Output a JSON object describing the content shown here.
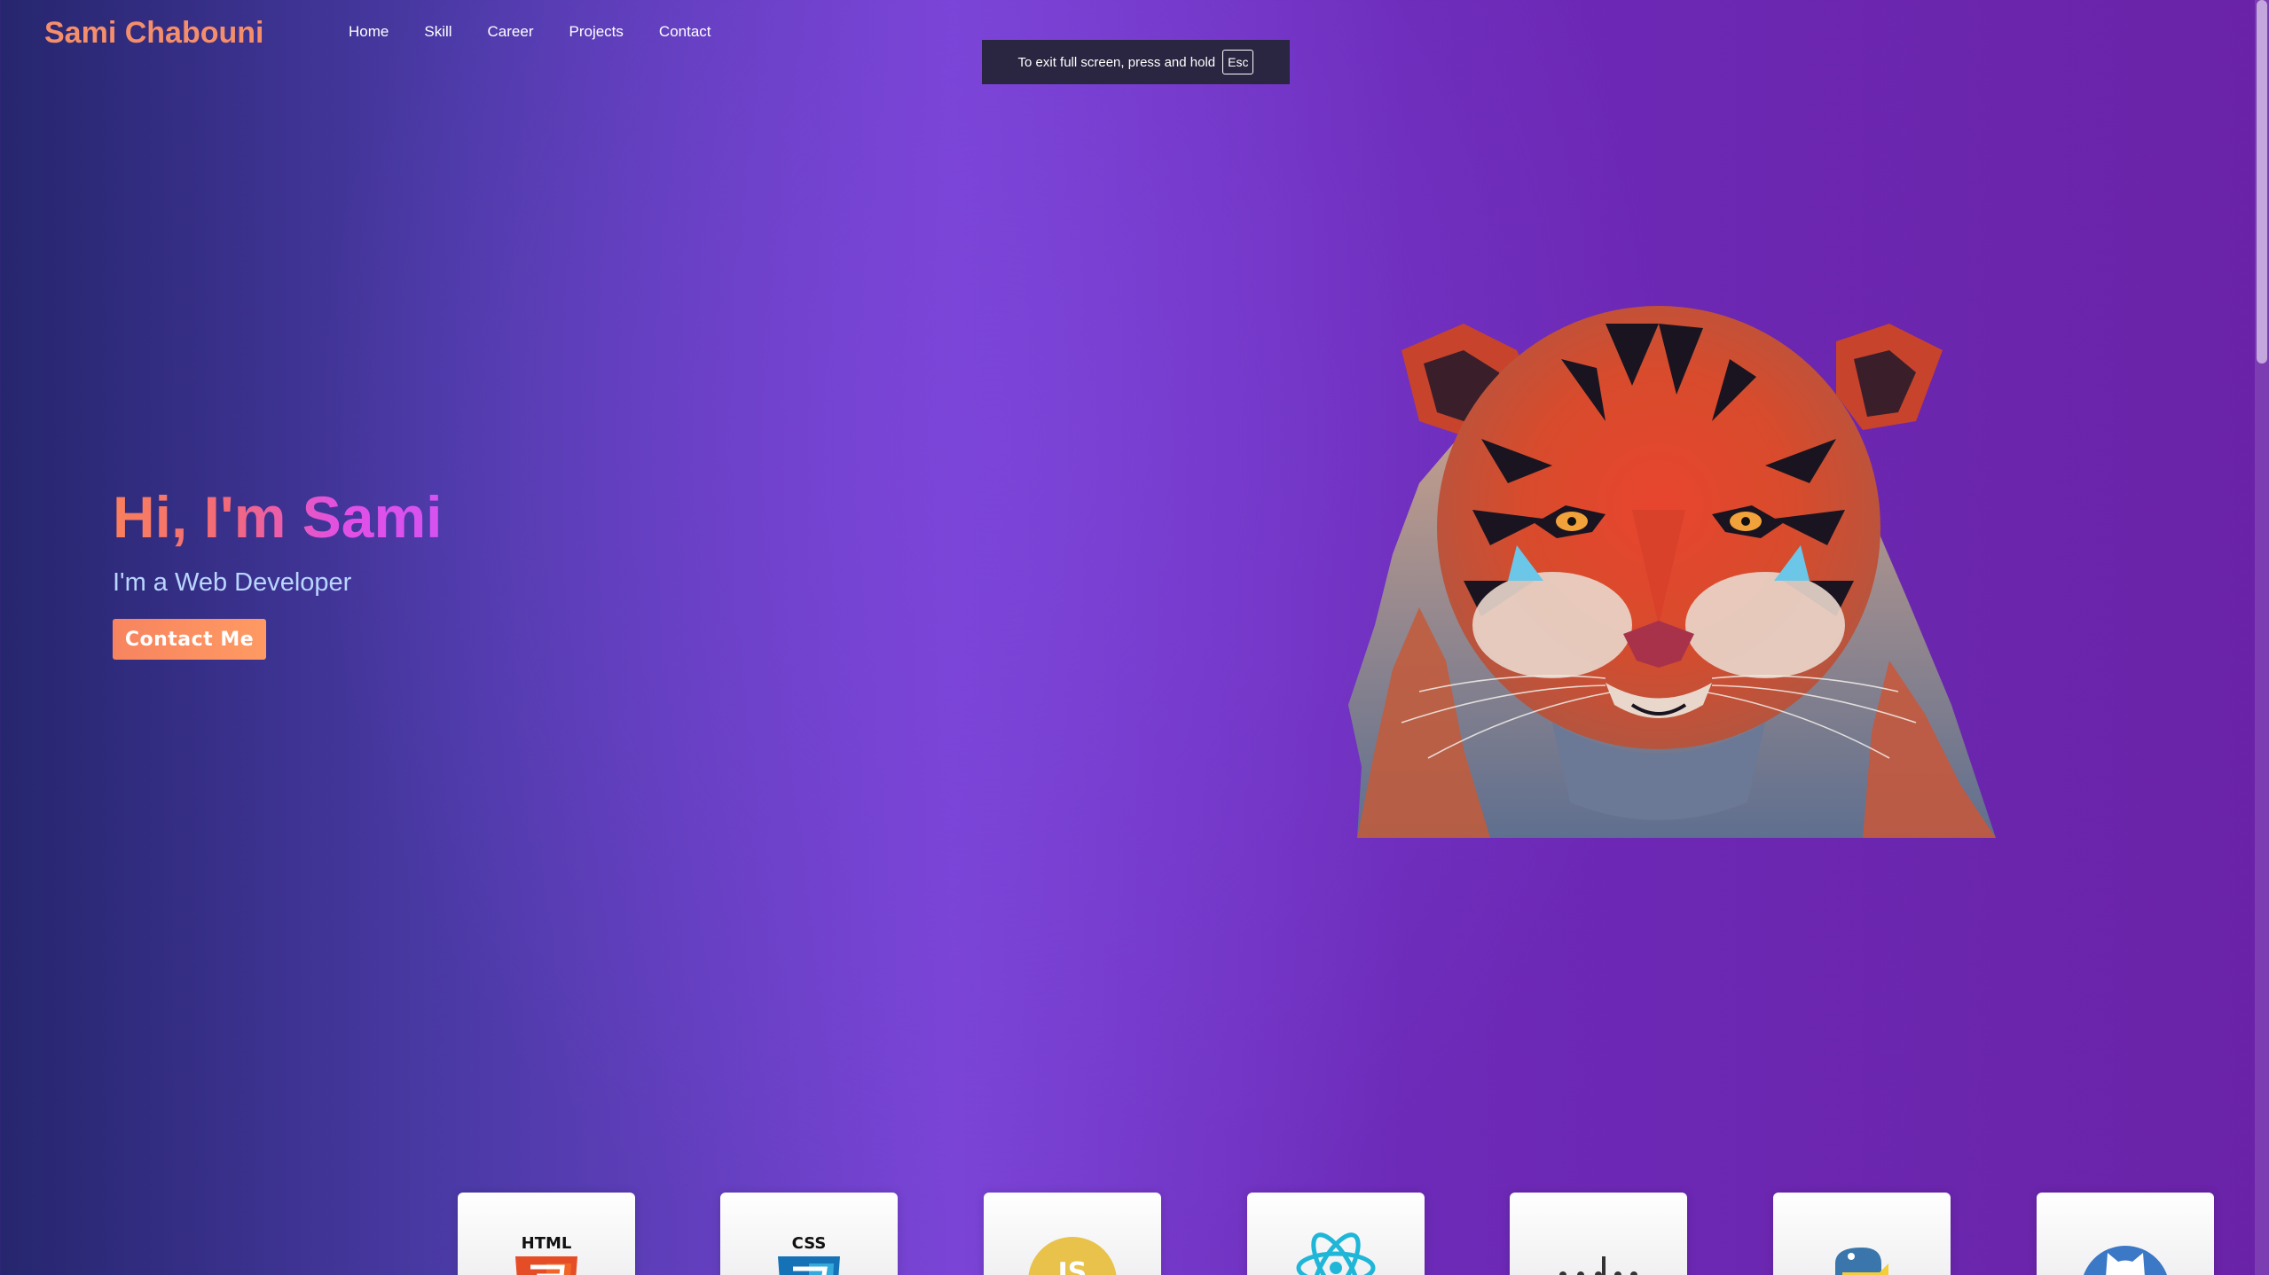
{
  "header": {
    "brand": "Sami Chabouni",
    "nav": [
      {
        "label": "Home"
      },
      {
        "label": "Skill"
      },
      {
        "label": "Career"
      },
      {
        "label": "Projects"
      },
      {
        "label": "Contact"
      }
    ]
  },
  "fullscreen_notice": {
    "text": "To exit full screen, press and hold",
    "key": "Esc"
  },
  "hero": {
    "title": "Hi, I'm Sami",
    "subtitle": "I'm a Web Developer",
    "cta_label": "Contact Me"
  },
  "colors": {
    "accent": "#f58e6a",
    "background_left": "#26266e",
    "background_mid": "#7a44d6",
    "background_right": "#6a23a8"
  },
  "skills": {
    "icons": [
      {
        "icon": "html5-icon",
        "label": "HTML"
      },
      {
        "icon": "css3-icon",
        "label": "CSS"
      },
      {
        "icon": "javascript-icon",
        "label": "JS"
      },
      {
        "icon": "react-icon"
      },
      {
        "icon": "nodejs-icon"
      },
      {
        "icon": "python-icon"
      },
      {
        "icon": "github-icon"
      }
    ]
  }
}
